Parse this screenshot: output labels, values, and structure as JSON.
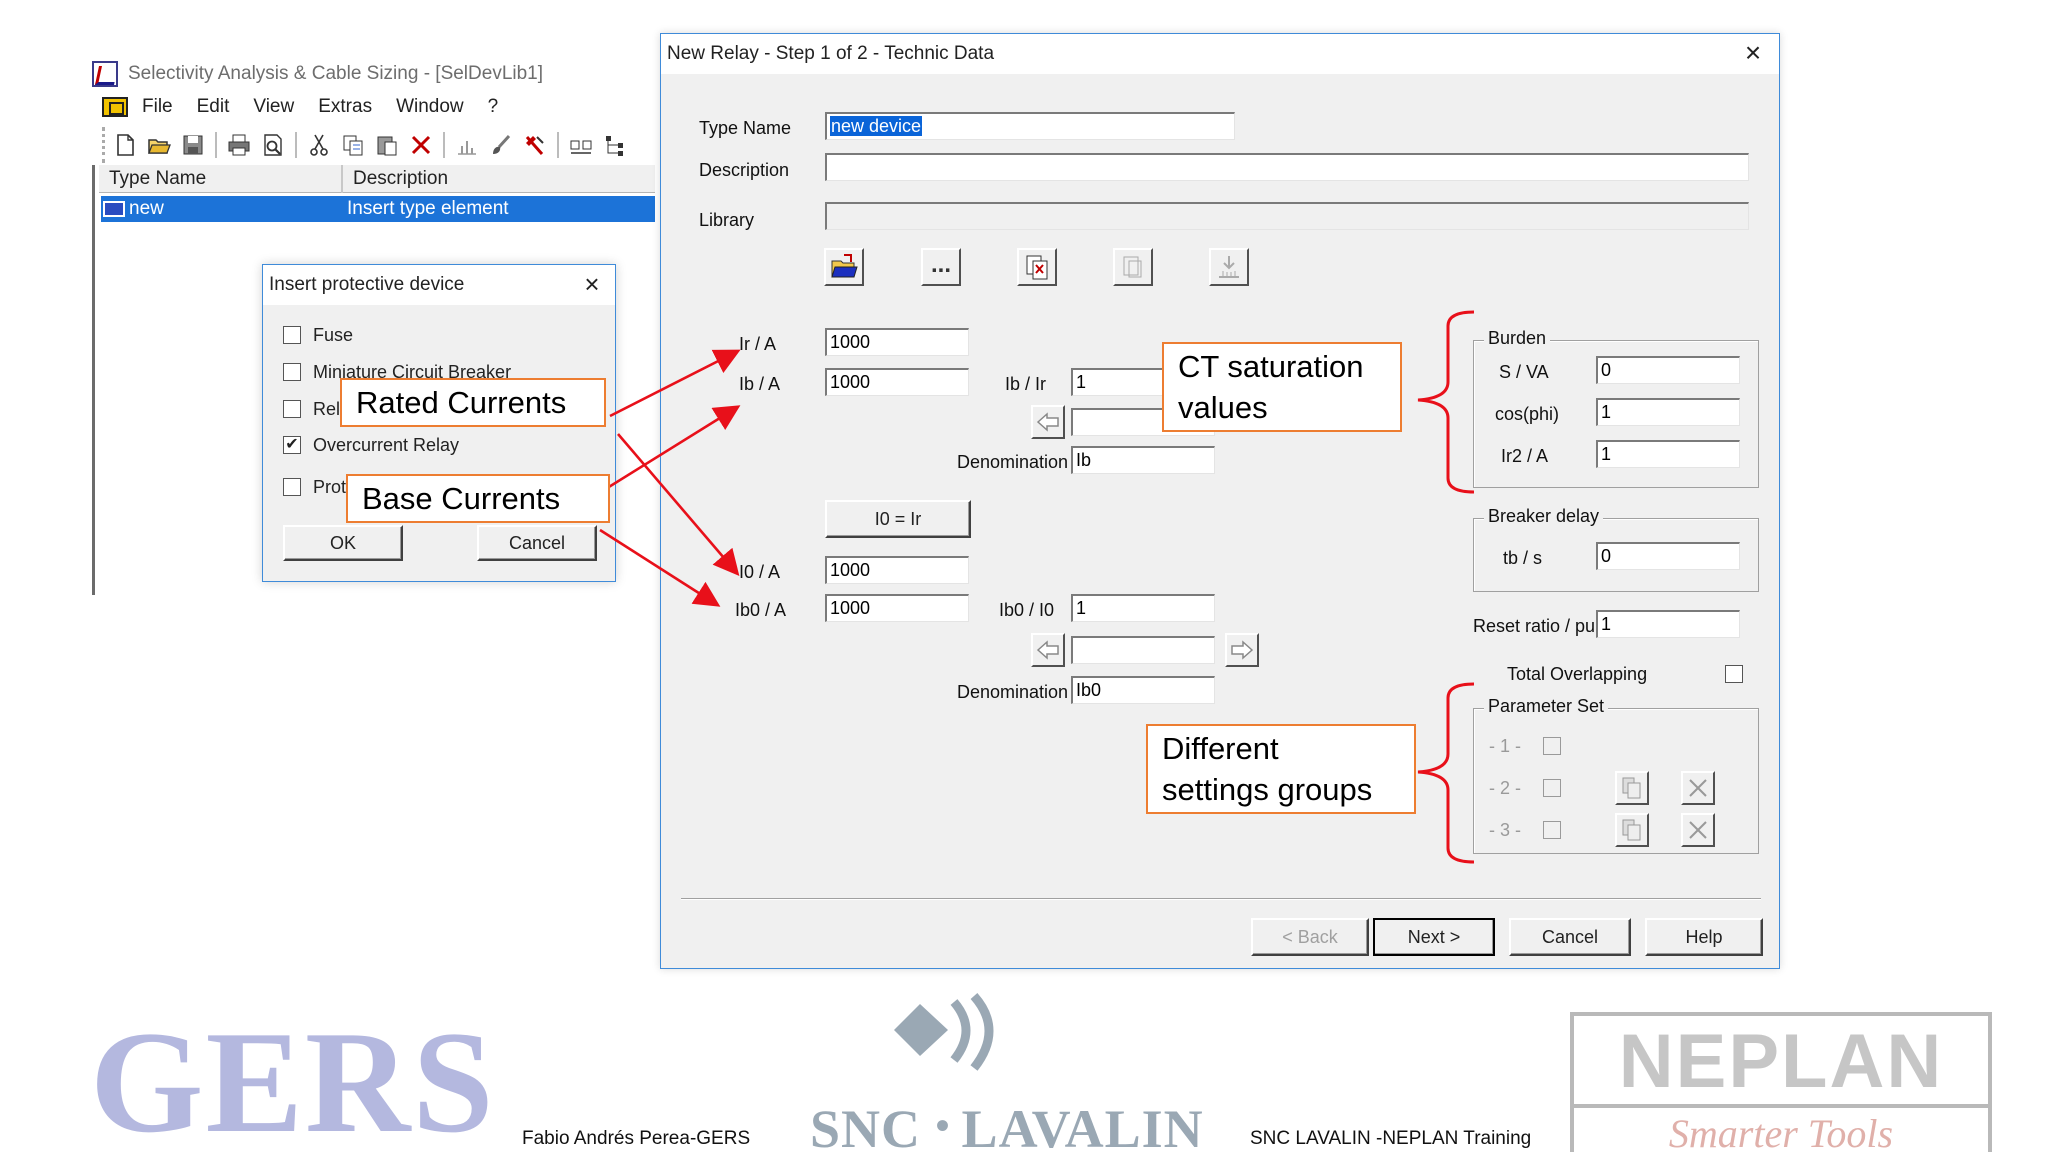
{
  "app": {
    "title": "Selectivity Analysis & Cable Sizing - [SelDevLib1]",
    "menu": [
      "File",
      "Edit",
      "View",
      "Extras",
      "Window",
      "?"
    ],
    "toolbar_icons": [
      "new-file-icon",
      "open-folder-icon",
      "save-icon",
      "print-icon",
      "print-preview-icon",
      "cut-icon",
      "copy-icon",
      "paste-icon",
      "delete-icon",
      "chart-icon",
      "brush-icon",
      "tool-icon",
      "compare-icon",
      "tree-icon"
    ],
    "list": {
      "columns": [
        "Type Name",
        "Description"
      ],
      "rows": [
        {
          "type_name": "new",
          "description": "Insert type element"
        }
      ]
    }
  },
  "insert_dialog": {
    "title": "Insert protective device",
    "options": [
      {
        "label": "Fuse",
        "checked": false
      },
      {
        "label": "Miniature Circuit Breaker",
        "checked": false
      },
      {
        "label": "Rel",
        "checked": false
      },
      {
        "label": "Overcurrent Relay",
        "checked": true
      },
      {
        "label": "Prot",
        "checked": false
      }
    ],
    "ok_label": "OK",
    "cancel_label": "Cancel"
  },
  "relay_dialog": {
    "title": "New Relay - Step 1 of 2 - Technic Data",
    "type_name_label": "Type Name",
    "type_name_value": "new device",
    "description_label": "Description",
    "description_value": "",
    "library_label": "Library",
    "library_value": "",
    "icons": [
      "open-folder-icon",
      "ellipsis-icon",
      "copy-library-icon",
      "import-icon",
      "export-icon"
    ],
    "ir_label": "Ir  / A",
    "ir_value": "1000",
    "ib_label": "Ib / A",
    "ib_value": "1000",
    "ib_ir_label": "Ib / Ir",
    "ib_ir_value": "1",
    "denom1_label": "Denomination",
    "denom1_value": "Ib",
    "i0_eq_ir_label": "I0 = Ir",
    "i0_label": "I0 / A",
    "i0_value": "1000",
    "ib0_label": "Ib0 / A",
    "ib0_value": "1000",
    "ib0_i0_label": "Ib0 / I0",
    "ib0_i0_value": "1",
    "denom2_label": "Denomination",
    "denom2_value": "Ib0",
    "burden": {
      "title": "Burden",
      "s_va_label": "S / VA",
      "s_va_value": "0",
      "cosphi_label": "cos(phi)",
      "cosphi_value": "1",
      "ir2_label": "Ir2 / A",
      "ir2_value": "1"
    },
    "breaker_delay": {
      "title": "Breaker delay",
      "tb_label": "tb / s",
      "tb_value": "0"
    },
    "reset_ratio_label": "Reset ratio / pu",
    "reset_ratio_value": "1",
    "total_overlapping_label": "Total Overlapping",
    "parameter_set": {
      "title": "Parameter Set",
      "rows": [
        "- 1 -",
        "- 2 -",
        "- 3 -"
      ]
    },
    "buttons": {
      "back": "< Back",
      "next": "Next >",
      "cancel": "Cancel",
      "help": "Help"
    }
  },
  "callouts": {
    "rated": "Rated Currents",
    "base": "Base Currents",
    "ct_line1": "CT saturation",
    "ct_line2": "values",
    "diff_line1": "Different",
    "diff_line2": "settings groups"
  },
  "colors": {
    "annotation_red": "#e8101a",
    "callout_border": "#ed7d31",
    "selection_blue": "#1c73d8"
  },
  "footer": {
    "gers": "GERS",
    "snc": "SNC",
    "lavalin": "LAVALIN",
    "neplan": "NEPLAN",
    "neplan_tagline": "Smarter Tools",
    "credit_left": "Fabio Andrés Perea-GERS",
    "credit_right": "SNC LAVALIN -NEPLAN Training"
  }
}
